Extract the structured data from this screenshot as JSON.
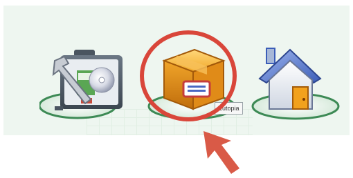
{
  "toolbar": {
    "items": [
      {
        "name": "tools",
        "icon": "toolbox-wrench-disc-icon"
      },
      {
        "name": "package",
        "icon": "package-box-icon",
        "tooltip": "Eutopia"
      },
      {
        "name": "home",
        "icon": "home-house-icon"
      }
    ]
  },
  "annotation": {
    "highlight_color": "#d9463a",
    "arrow_color": "#d95a47"
  }
}
